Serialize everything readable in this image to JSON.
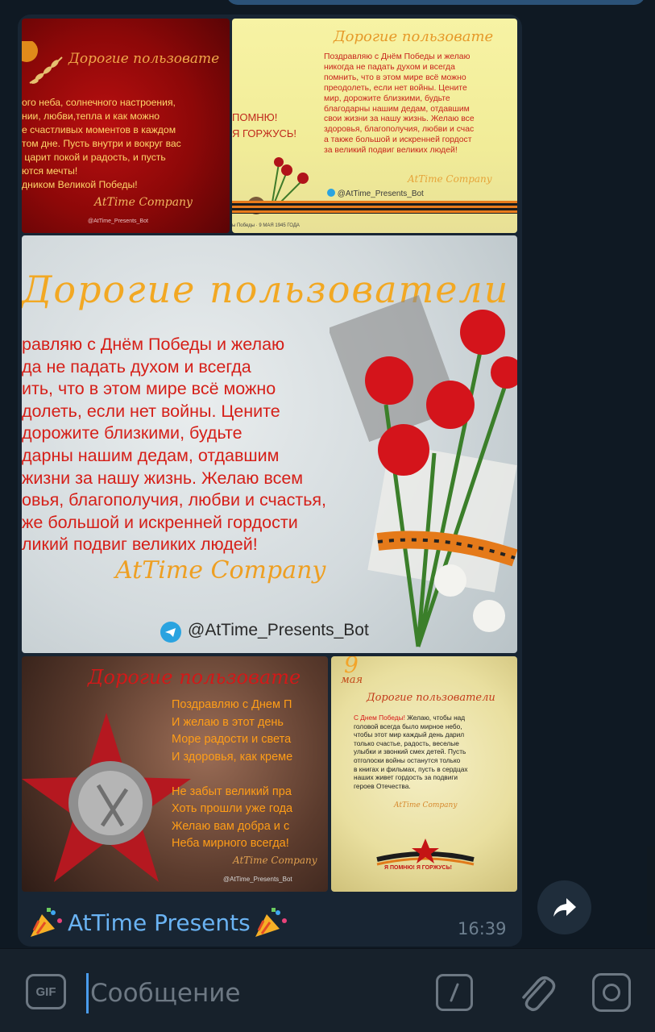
{
  "message": {
    "caption": "AtTime Presents",
    "time": "16:39",
    "images": [
      {
        "title": "Дорогие пользовате",
        "text": "ого неба, солнечного настроения,\nнии, любви,тепла и как можно\nе счастливых моментов в каждом\nтом дне. Пусть внутри и вокруг вас\n царит покой и радость, и пусть\nются мечты!\nдником Великой Победы!",
        "company": "AtTime Company",
        "bot": "@AtTime_Presents_Bot"
      },
      {
        "title": "Дорогие пользовате",
        "text": "Поздравляю с Днём Победы и желаю\nникогда не падать духом и всегда\nпомнить, что в этом мире всё можно\nпреодолеть, если нет войны. Цените\nмир, дорожите близкими, будьте\nблагодарны нашим дедам, отдавшим\nсвои жизни за нашу жизнь. Желаю все\nздоровья, благополучия, любви и счас\nа также большой и искренней гордост\nза великий подвиг великих людей!",
        "slogan": "ПОМНЮ!\nЯ ГОРЖУСЬ!",
        "company": "AtTime Company",
        "bot": "@AtTime_Presents_Bot",
        "date": "ы Победы · 9 МАЯ 1945 ГОДА"
      },
      {
        "title": "Дорогие пользователи",
        "text": "равляю с Днём Победы и желаю\nда не падать духом и всегда\nить, что в этом мире всё можно\nдолеть, если нет войны. Цените\nдорожите близкими, будьте\nдарны нашим дедам, отдавшим\nжизни за нашу жизнь. Желаю всем\nовья, благополучия, любви и счастья,\nже большой и искренней гордости\nликий подвиг великих людей!",
        "company": "AtTime Company",
        "bot": "@AtTime_Presents_Bot"
      },
      {
        "title": "Дорогие пользовате",
        "text": "Поздравляю с Днем П\nИ желаю в этот день\nМоре радости и света\nИ здоровья, как креме\n\nНе забыт великий пра\nХоть прошли уже года\nЖелаю вам добра и с\nНеба мирного всегда!",
        "company": "AtTime Company",
        "bot": "@AtTime_Presents_Bot"
      },
      {
        "day": "9",
        "month": "мая",
        "title": "Дорогие пользователи",
        "text_lead": "С Днем Победы!",
        "text": " Желаю, чтобы над\nголовой всегда было мирное небо,\nчтобы этот мир каждый день дарил\nтолько счастье, радость, веселые\nулыбки и звонкий смех детей. Пусть\nотголоски войны останутся только\nв книгах и фильмах, пусть в сердцах\nнаших живет гордость за подвиги\nгероев Отечества.",
        "company": "AtTime Company",
        "slogan": "Я ПОМНЮ! Я ГОРЖУСЬ!"
      }
    ]
  },
  "composer": {
    "gif_label": "GIF",
    "placeholder": "Сообщение"
  },
  "icons": {
    "caption_emoji": "party-popper-icon",
    "forward": "forward-arrow-icon",
    "attach": "paperclip-icon",
    "camera": "camera-icon",
    "commands": "slash-command-icon"
  },
  "colors": {
    "background": "#0e1621",
    "bubble": "#182533",
    "link": "#6ab3f3",
    "time": "#6d7f8f",
    "composer": "#17212b",
    "cursor": "#4a9cec"
  }
}
